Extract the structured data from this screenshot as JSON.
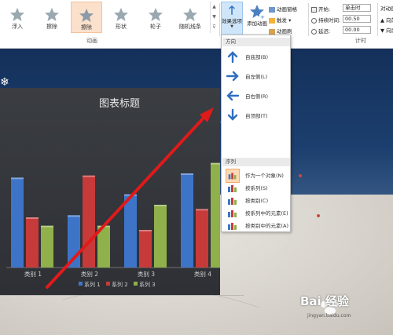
{
  "ribbon": {
    "gallery": [
      {
        "label": "浮入",
        "icon": "star-green-icon",
        "selected": false
      },
      {
        "label": "擦除",
        "icon": "star-green-icon",
        "selected": false
      },
      {
        "label": "擦除",
        "icon": "star-green-icon",
        "selected": true
      },
      {
        "label": "形状",
        "icon": "star-green-icon",
        "selected": false
      },
      {
        "label": "轮子",
        "icon": "star-green-icon",
        "selected": false
      },
      {
        "label": "随机线条",
        "icon": "star-green-icon",
        "selected": false
      }
    ],
    "group_animation_label": "动画",
    "effect_options_label": "效果选项",
    "add_animation_label": "添加动画",
    "animation_pane_label": "动画窗格",
    "trigger_label": "触发",
    "animation_painter_label": "动画刷",
    "start_label": "开始:",
    "start_value": "单击时",
    "duration_label": "持续时间:",
    "duration_value": "00.50",
    "delay_label": "延迟:",
    "delay_value": "00.00",
    "group_timing_label": "计时",
    "reorder_title": "对动画",
    "reorder_forward": "向前",
    "reorder_back": "向后"
  },
  "menu": {
    "direction_header": "方向",
    "sequence_header": "序列",
    "direction_items": [
      {
        "label": "自底部(B)",
        "icon": "arrow-up-icon"
      },
      {
        "label": "自左侧(L)",
        "icon": "arrow-right-icon"
      },
      {
        "label": "自右侧(R)",
        "icon": "arrow-left-icon"
      },
      {
        "label": "自顶部(T)",
        "icon": "arrow-down-icon"
      }
    ],
    "sequence_items": [
      {
        "label": "作为一个对象(N)",
        "checked": true
      },
      {
        "label": "按系列(S)",
        "checked": false
      },
      {
        "label": "按类别(C)",
        "checked": false
      },
      {
        "label": "按系列中的元素(E)",
        "checked": false
      },
      {
        "label": "按类别中的元素(A)",
        "checked": false
      }
    ]
  },
  "chart_data": {
    "type": "bar",
    "title": "图表标题",
    "categories": [
      "类别 1",
      "类别 2",
      "类别 3",
      "类别 4"
    ],
    "series": [
      {
        "name": "系列 1",
        "values": [
          4.3,
          2.5,
          3.5,
          4.5
        ],
        "color": "#3e74c8"
      },
      {
        "name": "系列 2",
        "values": [
          2.4,
          4.4,
          1.8,
          2.8
        ],
        "color": "#c73a3a"
      },
      {
        "name": "系列 3",
        "values": [
          2.0,
          2.0,
          3.0,
          5.0
        ],
        "color": "#8fb04a"
      }
    ],
    "ylim": [
      0,
      6
    ],
    "legend_position": "bottom",
    "grid": false
  },
  "watermark": {
    "brand": "Bai 经验",
    "url": "jingyan.baidu.com"
  },
  "colors": {
    "accent": "#2f6fc0",
    "annotation_arrow": "#e01a1a",
    "selected_fill": "#fbe0cc"
  }
}
